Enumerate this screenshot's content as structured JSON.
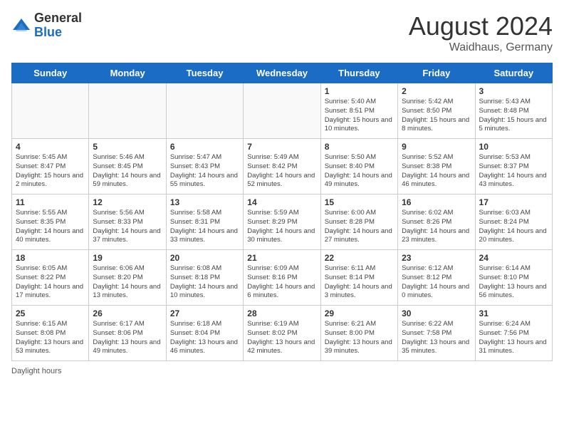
{
  "header": {
    "logo_general": "General",
    "logo_blue": "Blue",
    "title": "August 2024",
    "subtitle": "Waidhaus, Germany"
  },
  "days_of_week": [
    "Sunday",
    "Monday",
    "Tuesday",
    "Wednesday",
    "Thursday",
    "Friday",
    "Saturday"
  ],
  "weeks": [
    [
      {
        "day": "",
        "info": ""
      },
      {
        "day": "",
        "info": ""
      },
      {
        "day": "",
        "info": ""
      },
      {
        "day": "",
        "info": ""
      },
      {
        "day": "1",
        "info": "Sunrise: 5:40 AM\nSunset: 8:51 PM\nDaylight: 15 hours and 10 minutes."
      },
      {
        "day": "2",
        "info": "Sunrise: 5:42 AM\nSunset: 8:50 PM\nDaylight: 15 hours and 8 minutes."
      },
      {
        "day": "3",
        "info": "Sunrise: 5:43 AM\nSunset: 8:48 PM\nDaylight: 15 hours and 5 minutes."
      }
    ],
    [
      {
        "day": "4",
        "info": "Sunrise: 5:45 AM\nSunset: 8:47 PM\nDaylight: 15 hours and 2 minutes."
      },
      {
        "day": "5",
        "info": "Sunrise: 5:46 AM\nSunset: 8:45 PM\nDaylight: 14 hours and 59 minutes."
      },
      {
        "day": "6",
        "info": "Sunrise: 5:47 AM\nSunset: 8:43 PM\nDaylight: 14 hours and 55 minutes."
      },
      {
        "day": "7",
        "info": "Sunrise: 5:49 AM\nSunset: 8:42 PM\nDaylight: 14 hours and 52 minutes."
      },
      {
        "day": "8",
        "info": "Sunrise: 5:50 AM\nSunset: 8:40 PM\nDaylight: 14 hours and 49 minutes."
      },
      {
        "day": "9",
        "info": "Sunrise: 5:52 AM\nSunset: 8:38 PM\nDaylight: 14 hours and 46 minutes."
      },
      {
        "day": "10",
        "info": "Sunrise: 5:53 AM\nSunset: 8:37 PM\nDaylight: 14 hours and 43 minutes."
      }
    ],
    [
      {
        "day": "11",
        "info": "Sunrise: 5:55 AM\nSunset: 8:35 PM\nDaylight: 14 hours and 40 minutes."
      },
      {
        "day": "12",
        "info": "Sunrise: 5:56 AM\nSunset: 8:33 PM\nDaylight: 14 hours and 37 minutes."
      },
      {
        "day": "13",
        "info": "Sunrise: 5:58 AM\nSunset: 8:31 PM\nDaylight: 14 hours and 33 minutes."
      },
      {
        "day": "14",
        "info": "Sunrise: 5:59 AM\nSunset: 8:29 PM\nDaylight: 14 hours and 30 minutes."
      },
      {
        "day": "15",
        "info": "Sunrise: 6:00 AM\nSunset: 8:28 PM\nDaylight: 14 hours and 27 minutes."
      },
      {
        "day": "16",
        "info": "Sunrise: 6:02 AM\nSunset: 8:26 PM\nDaylight: 14 hours and 23 minutes."
      },
      {
        "day": "17",
        "info": "Sunrise: 6:03 AM\nSunset: 8:24 PM\nDaylight: 14 hours and 20 minutes."
      }
    ],
    [
      {
        "day": "18",
        "info": "Sunrise: 6:05 AM\nSunset: 8:22 PM\nDaylight: 14 hours and 17 minutes."
      },
      {
        "day": "19",
        "info": "Sunrise: 6:06 AM\nSunset: 8:20 PM\nDaylight: 14 hours and 13 minutes."
      },
      {
        "day": "20",
        "info": "Sunrise: 6:08 AM\nSunset: 8:18 PM\nDaylight: 14 hours and 10 minutes."
      },
      {
        "day": "21",
        "info": "Sunrise: 6:09 AM\nSunset: 8:16 PM\nDaylight: 14 hours and 6 minutes."
      },
      {
        "day": "22",
        "info": "Sunrise: 6:11 AM\nSunset: 8:14 PM\nDaylight: 14 hours and 3 minutes."
      },
      {
        "day": "23",
        "info": "Sunrise: 6:12 AM\nSunset: 8:12 PM\nDaylight: 14 hours and 0 minutes."
      },
      {
        "day": "24",
        "info": "Sunrise: 6:14 AM\nSunset: 8:10 PM\nDaylight: 13 hours and 56 minutes."
      }
    ],
    [
      {
        "day": "25",
        "info": "Sunrise: 6:15 AM\nSunset: 8:08 PM\nDaylight: 13 hours and 53 minutes."
      },
      {
        "day": "26",
        "info": "Sunrise: 6:17 AM\nSunset: 8:06 PM\nDaylight: 13 hours and 49 minutes."
      },
      {
        "day": "27",
        "info": "Sunrise: 6:18 AM\nSunset: 8:04 PM\nDaylight: 13 hours and 46 minutes."
      },
      {
        "day": "28",
        "info": "Sunrise: 6:19 AM\nSunset: 8:02 PM\nDaylight: 13 hours and 42 minutes."
      },
      {
        "day": "29",
        "info": "Sunrise: 6:21 AM\nSunset: 8:00 PM\nDaylight: 13 hours and 39 minutes."
      },
      {
        "day": "30",
        "info": "Sunrise: 6:22 AM\nSunset: 7:58 PM\nDaylight: 13 hours and 35 minutes."
      },
      {
        "day": "31",
        "info": "Sunrise: 6:24 AM\nSunset: 7:56 PM\nDaylight: 13 hours and 31 minutes."
      }
    ]
  ],
  "footer": {
    "label": "Daylight hours"
  }
}
